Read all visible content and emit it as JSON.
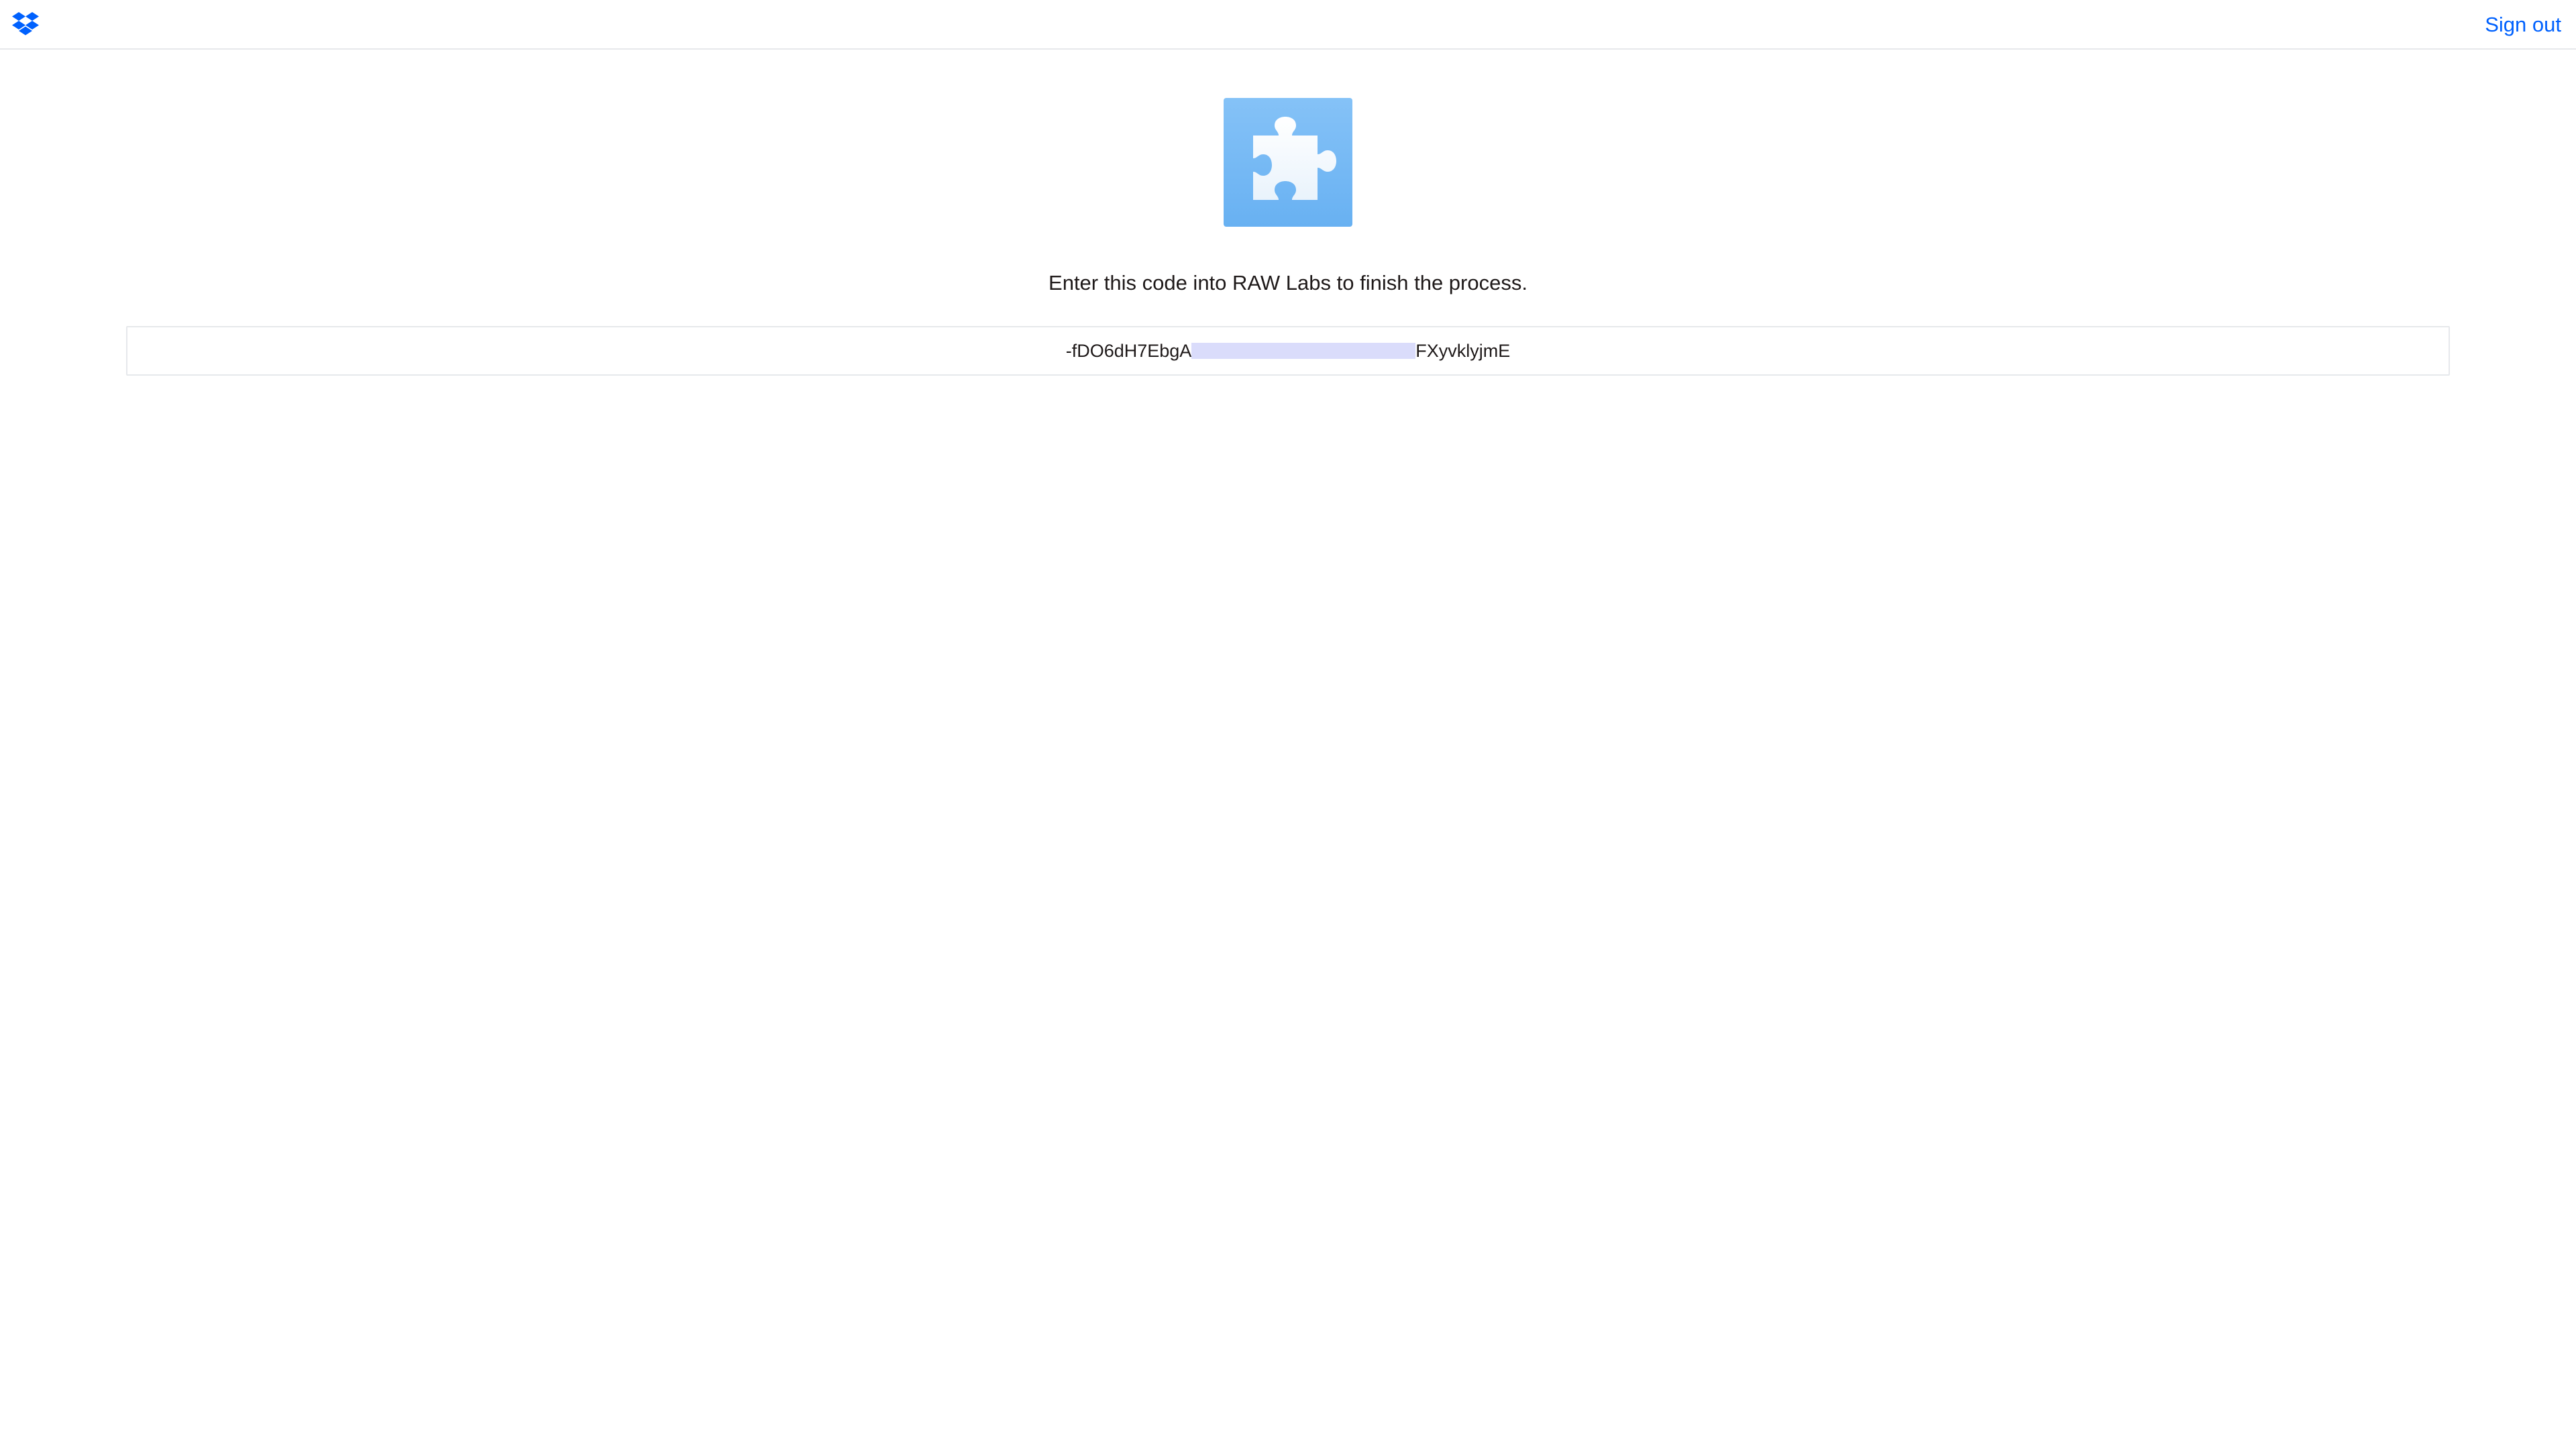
{
  "header": {
    "logo_icon": "dropbox-logo-icon",
    "signout_label": "Sign out",
    "accent_color": "#0061fe"
  },
  "app": {
    "icon": "puzzle-piece-icon",
    "icon_bg_color": "#74b8f4"
  },
  "main": {
    "instruction": "Enter this code into RAW Labs to finish the process.",
    "code": {
      "prefix": "-fDO6dH7EbgA",
      "suffix": "FXyvklyjmE"
    }
  }
}
